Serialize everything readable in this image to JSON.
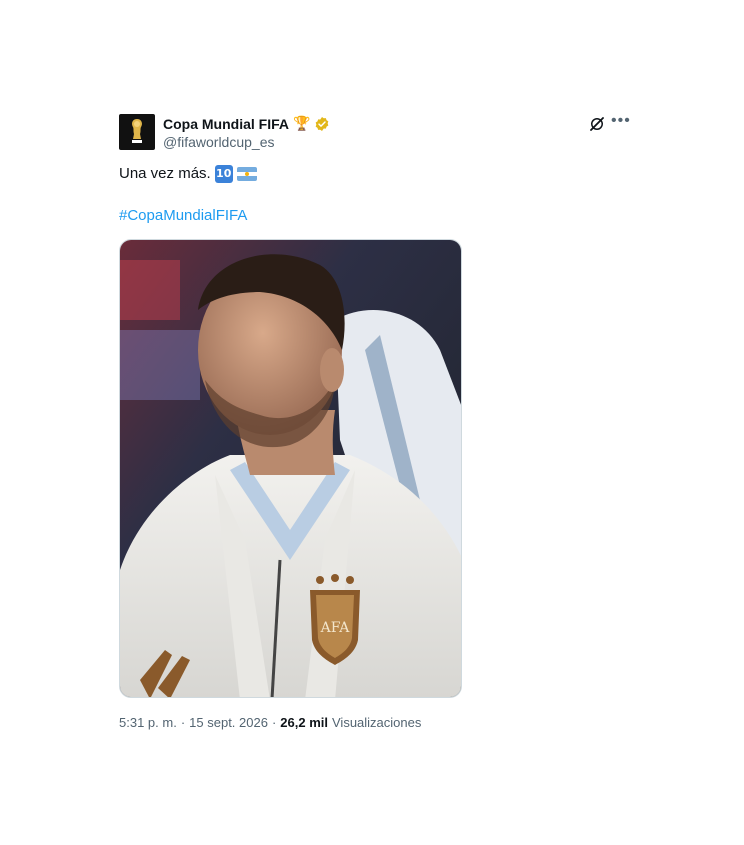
{
  "account": {
    "name": "Copa Mundial FIFA",
    "name_emoji": "🏆",
    "handle": "@fifaworldcup_es"
  },
  "tweet": {
    "text": "Una vez más.",
    "emoji_keycap": "10",
    "hashtag": "#CopaMundialFIFA",
    "time": "5:31 p. m.",
    "separator": "·",
    "date": "15 sept. 2026",
    "views_count": "26,2 mil",
    "views_label": "Visualizaciones"
  },
  "colors": {
    "link": "#1d9bf0",
    "verified_badge": "#e2b719",
    "secondary_text": "#536471"
  },
  "icons": {
    "grok": "grok-icon",
    "more": "more-icon",
    "verified": "verified-badge-icon"
  }
}
